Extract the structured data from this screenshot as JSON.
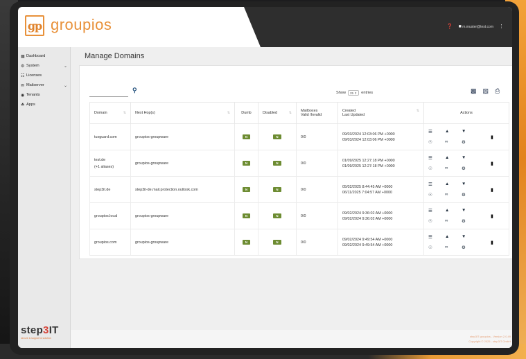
{
  "app": {
    "logo_mark": "gp",
    "logo_text": "groupios",
    "user_email": "m.muster@test.com"
  },
  "sidebar": {
    "items": [
      {
        "label": "Dashboard",
        "icon": "dashboard-icon",
        "glyph": "▦",
        "has_chevron": false
      },
      {
        "label": "System",
        "icon": "gear-icon",
        "glyph": "⚙",
        "has_chevron": true
      },
      {
        "label": "Licenses",
        "icon": "license-icon",
        "glyph": "☷",
        "has_chevron": false
      },
      {
        "label": "Mailserver",
        "icon": "mail-icon",
        "glyph": "✉",
        "has_chevron": true
      },
      {
        "label": "Tenants",
        "icon": "eye-icon",
        "glyph": "◉",
        "has_chevron": false
      },
      {
        "label": "Apps",
        "icon": "apps-icon",
        "glyph": "☘",
        "has_chevron": false
      }
    ],
    "brand": {
      "prefix": "step",
      "accent": "3",
      "suffix": "IT",
      "tagline": "secure & support & solution"
    }
  },
  "main": {
    "title": "Manage Domains",
    "show_label": "Show",
    "entries_value": "25",
    "entries_label": "entries"
  },
  "table": {
    "headers": {
      "domain": "Domain",
      "next_hop": "Next Hop(s)",
      "dumb": "Dumb",
      "disabled": "Disabled",
      "mailboxes_line1": "Mailboxes",
      "mailboxes_line2": "Valid /Invalid",
      "created_line1": "Created",
      "created_line2": "Last Updated",
      "actions": "Actions"
    },
    "rows": [
      {
        "domain": "tuxguard.com",
        "domain_sub": "",
        "next_hop": "groupios-groupware",
        "dumb": "N",
        "disabled": "N",
        "mailboxes": "0/0",
        "created": "09/03/2024 12:03:06 PM +0000",
        "updated": "09/03/2024 12:03:06 PM +0000"
      },
      {
        "domain": "test.de",
        "domain_sub": "(+1 aliases)",
        "next_hop": "groupios-groupware",
        "dumb": "N",
        "disabled": "N",
        "mailboxes": "0/0",
        "created": "01/09/2025 12:27:18 PM +0000",
        "updated": "01/09/2025 12:27:18 PM +0000"
      },
      {
        "domain": "step3it.de",
        "domain_sub": "",
        "next_hop": "step3it-de.mail.protection.outlook.com",
        "dumb": "N",
        "disabled": "N",
        "mailboxes": "0/0",
        "created": "05/02/2025 8:44:45 AM +0000",
        "updated": "06/11/2025 7:04:57 AM +0000"
      },
      {
        "domain": "groupios.local",
        "domain_sub": "",
        "next_hop": "groupios-groupware",
        "dumb": "N",
        "disabled": "N",
        "mailboxes": "0/0",
        "created": "09/02/2024 9:36:02 AM +0000",
        "updated": "09/02/2024 9:36:02 AM +0000"
      },
      {
        "domain": "groupios.com",
        "domain_sub": "",
        "next_hop": "groupios-groupware",
        "dumb": "N",
        "disabled": "N",
        "mailboxes": "0/0",
        "created": "09/02/2024 9:49:54 AM +0000",
        "updated": "09/02/2024 9:49:54 AM +0000"
      }
    ],
    "row_action_icons": [
      "list-icon",
      "thumbs-up-icon",
      "thumbs-down-icon",
      "globe-icon",
      "link-icon",
      "gear-icon",
      "trash-icon"
    ]
  },
  "footer": {
    "line1": "step3IT groupios - Version 2.0.49",
    "line2": "Copyright © 2025 - step3IT GmbH"
  },
  "colors": {
    "accent": "#e8913a",
    "badge": "#6d8c32",
    "topbar": "#2e2e2e"
  }
}
